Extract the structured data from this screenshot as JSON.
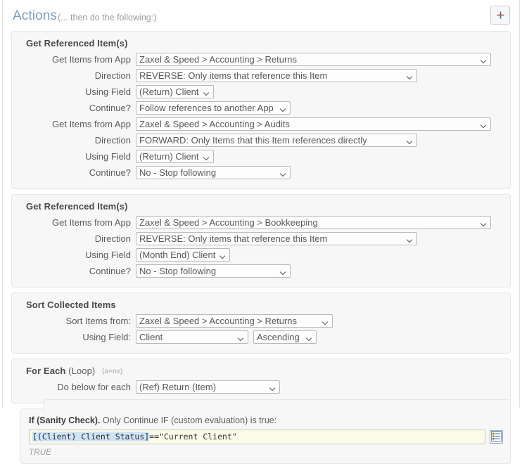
{
  "header": {
    "title": "Actions",
    "subtitle": "(... then do the following:)",
    "add_button_label": "+",
    "title_color": "#7c9dc4"
  },
  "cards": [
    {
      "heading": "Get Referenced Item(s)",
      "rows": [
        {
          "label": "Get Items from App",
          "value": "Zaxel & Speed > Accounting > Returns"
        },
        {
          "label": "Direction",
          "value": "REVERSE: Only items that reference this Item"
        },
        {
          "label": "Using Field",
          "value": "(Return) Client"
        },
        {
          "label": "Continue?",
          "value": "Follow references to another App"
        },
        {
          "label": "Get Items from App",
          "value": "Zaxel & Speed > Accounting > Audits"
        },
        {
          "label": "Direction",
          "value": "FORWARD: Only Items that this Item references directly"
        },
        {
          "label": "Using Field",
          "value": "(Return) Client"
        },
        {
          "label": "Continue?",
          "value": "No - Stop following"
        }
      ]
    },
    {
      "heading": "Get Referenced Item(s)",
      "rows": [
        {
          "label": "Get Items from App",
          "value": "Zaxel & Speed > Accounting > Bookkeeping"
        },
        {
          "label": "Direction",
          "value": "REVERSE: Only items that reference this Item"
        },
        {
          "label": "Using Field",
          "value": "(Month End) Client"
        },
        {
          "label": "Continue?",
          "value": "No - Stop following"
        }
      ]
    },
    {
      "heading": "Sort Collected Items",
      "rows": [
        {
          "label": "Sort Items from:",
          "value": "Zaxel & Speed > Accounting > Returns"
        },
        {
          "label": "Using Field:",
          "value": "Client",
          "value2": "Ascending"
        }
      ]
    },
    {
      "heading_main": "For Each",
      "heading_light": "(Loop)",
      "heading_note": "(a=nx)",
      "rows": [
        {
          "label": "Do below for each",
          "value": "(Ref) Return (Item)"
        }
      ]
    }
  ],
  "if_block": {
    "title_bold": "If (Sanity Check).",
    "title_rest": " Only Continue IF (custom evaluation) is true:",
    "formula_token": "[(Client) Client Status]",
    "formula_rest": "==\"Current Client\"",
    "result": "TRUE",
    "picker_icon": "field-picker-icon",
    "highlight_color": "#cfe4f7",
    "input_background": "#fbfbe8"
  }
}
